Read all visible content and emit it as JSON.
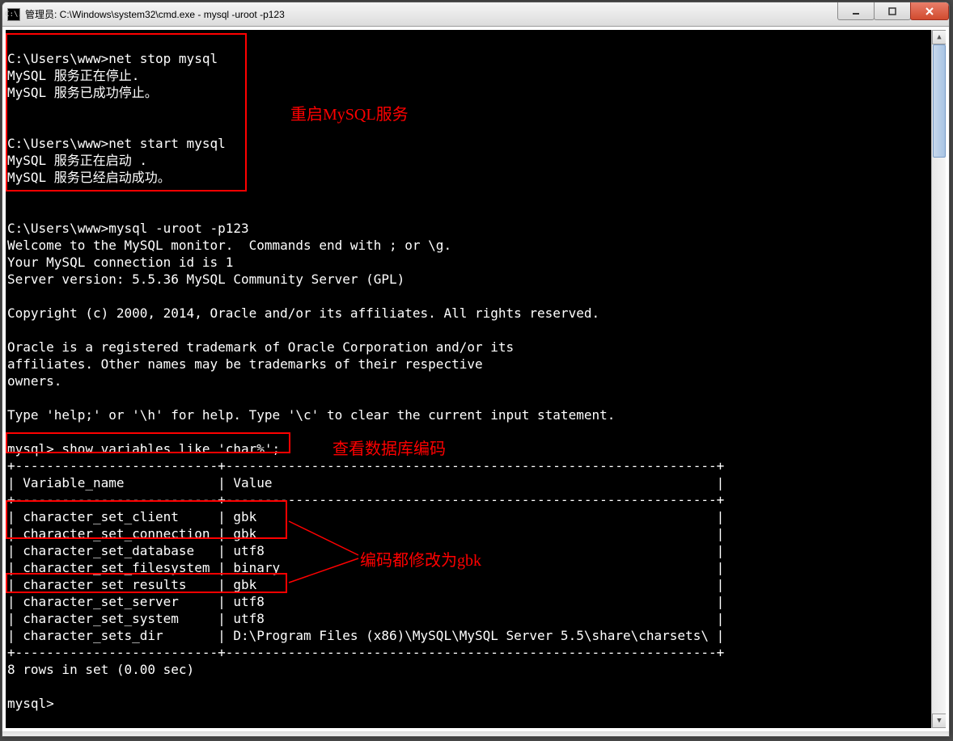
{
  "window": {
    "icon_text": "C:\\.",
    "title": "管理员: C:\\Windows\\system32\\cmd.exe - mysql  -uroot -p123"
  },
  "terminal": {
    "lines": [
      "",
      "C:\\Users\\www>net stop mysql",
      "MySQL 服务正在停止.",
      "MySQL 服务已成功停止。",
      "",
      "",
      "C:\\Users\\www>net start mysql",
      "MySQL 服务正在启动 .",
      "MySQL 服务已经启动成功。",
      "",
      "",
      "C:\\Users\\www>mysql -uroot -p123",
      "Welcome to the MySQL monitor.  Commands end with ; or \\g.",
      "Your MySQL connection id is 1",
      "Server version: 5.5.36 MySQL Community Server (GPL)",
      "",
      "Copyright (c) 2000, 2014, Oracle and/or its affiliates. All rights reserved.",
      "",
      "Oracle is a registered trademark of Oracle Corporation and/or its",
      "affiliates. Other names may be trademarks of their respective",
      "owners.",
      "",
      "Type 'help;' or '\\h' for help. Type '\\c' to clear the current input statement.",
      "",
      "mysql> show variables like 'char%';",
      "+--------------------------+---------------------------------------------------------------+",
      "| Variable_name            | Value                                                         |",
      "+--------------------------+---------------------------------------------------------------+",
      "| character_set_client     | gbk                                                           |",
      "| character_set_connection | gbk                                                           |",
      "| character_set_database   | utf8                                                          |",
      "| character_set_filesystem | binary                                                        |",
      "| character_set_results    | gbk                                                           |",
      "| character_set_server     | utf8                                                          |",
      "| character_set_system     | utf8                                                          |",
      "| character_sets_dir       | D:\\Program Files (x86)\\MySQL\\MySQL Server 5.5\\share\\charsets\\ |",
      "+--------------------------+---------------------------------------------------------------+",
      "8 rows in set (0.00 sec)",
      "",
      "mysql>"
    ]
  },
  "annotations": {
    "restart_note": "重启MySQL服务",
    "show_encoding_note": "查看数据库编码",
    "gbk_note": "编码都修改为gbk"
  },
  "mysql_variables": {
    "header_name": "Variable_name",
    "header_value": "Value",
    "rows": [
      {
        "name": "character_set_client",
        "value": "gbk"
      },
      {
        "name": "character_set_connection",
        "value": "gbk"
      },
      {
        "name": "character_set_database",
        "value": "utf8"
      },
      {
        "name": "character_set_filesystem",
        "value": "binary"
      },
      {
        "name": "character_set_results",
        "value": "gbk"
      },
      {
        "name": "character_set_server",
        "value": "utf8"
      },
      {
        "name": "character_set_system",
        "value": "utf8"
      },
      {
        "name": "character_sets_dir",
        "value": "D:\\Program Files (x86)\\MySQL\\MySQL Server 5.5\\share\\charsets\\"
      }
    ],
    "rows_in_set": "8 rows in set (0.00 sec)"
  }
}
